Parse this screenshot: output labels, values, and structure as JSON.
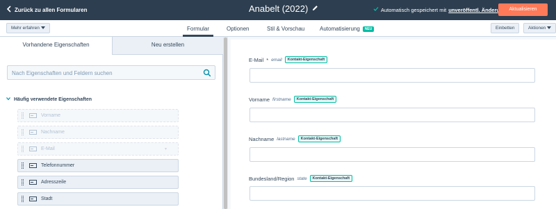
{
  "topbar": {
    "back_label": "Zurück zu allen Formularen",
    "form_title": "Anabelt (2022)",
    "autosave_text": "Automatisch gespeichert mit",
    "autosave_link": "unveröffentl. Änderungen",
    "publish_label": "Aktualisieren"
  },
  "tabbar": {
    "more_label": "Mehr erfahren",
    "tabs": {
      "form": "Formular",
      "options": "Optionen",
      "style": "Stil & Vorschau",
      "automation": "Automatisierung"
    },
    "new_badge": "NEU",
    "embed_label": "Einbetten",
    "actions_label": "Aktionen"
  },
  "leftpanel": {
    "subtab_existing": "Vorhandene Eigenschaften",
    "subtab_new": "Neu erstellen",
    "search_placeholder": "Nach Eigenschaften und Feldern suchen",
    "group_title": "Häufig verwendete Eigenschaften",
    "properties": [
      {
        "label": "Vorname",
        "state": "disabled"
      },
      {
        "label": "Nachname",
        "state": "disabled"
      },
      {
        "label": "E-Mail",
        "state": "disabled"
      },
      {
        "label": "Telefonnummer",
        "state": "enabled"
      },
      {
        "label": "Adresszeile",
        "state": "enabled"
      },
      {
        "label": "Stadt",
        "state": "enabled"
      }
    ]
  },
  "form": {
    "fields": [
      {
        "label": "E-Mail",
        "required_mark": "*",
        "internal": "email",
        "tag": "Kontakt-Eigenschaft"
      },
      {
        "label": "Vorname",
        "internal": "firstname",
        "tag": "Kontakt-Eigenschaft"
      },
      {
        "label": "Nachname",
        "internal": "lastname",
        "tag": "Kontakt-Eigenschaft"
      },
      {
        "label": "Bundesland/Region",
        "internal": "state",
        "tag": "Kontakt-Eigenschaft"
      }
    ]
  },
  "colors": {
    "topbar_bg": "#2d3e50",
    "accent_orange": "#ff7a59",
    "teal": "#00bda5"
  }
}
